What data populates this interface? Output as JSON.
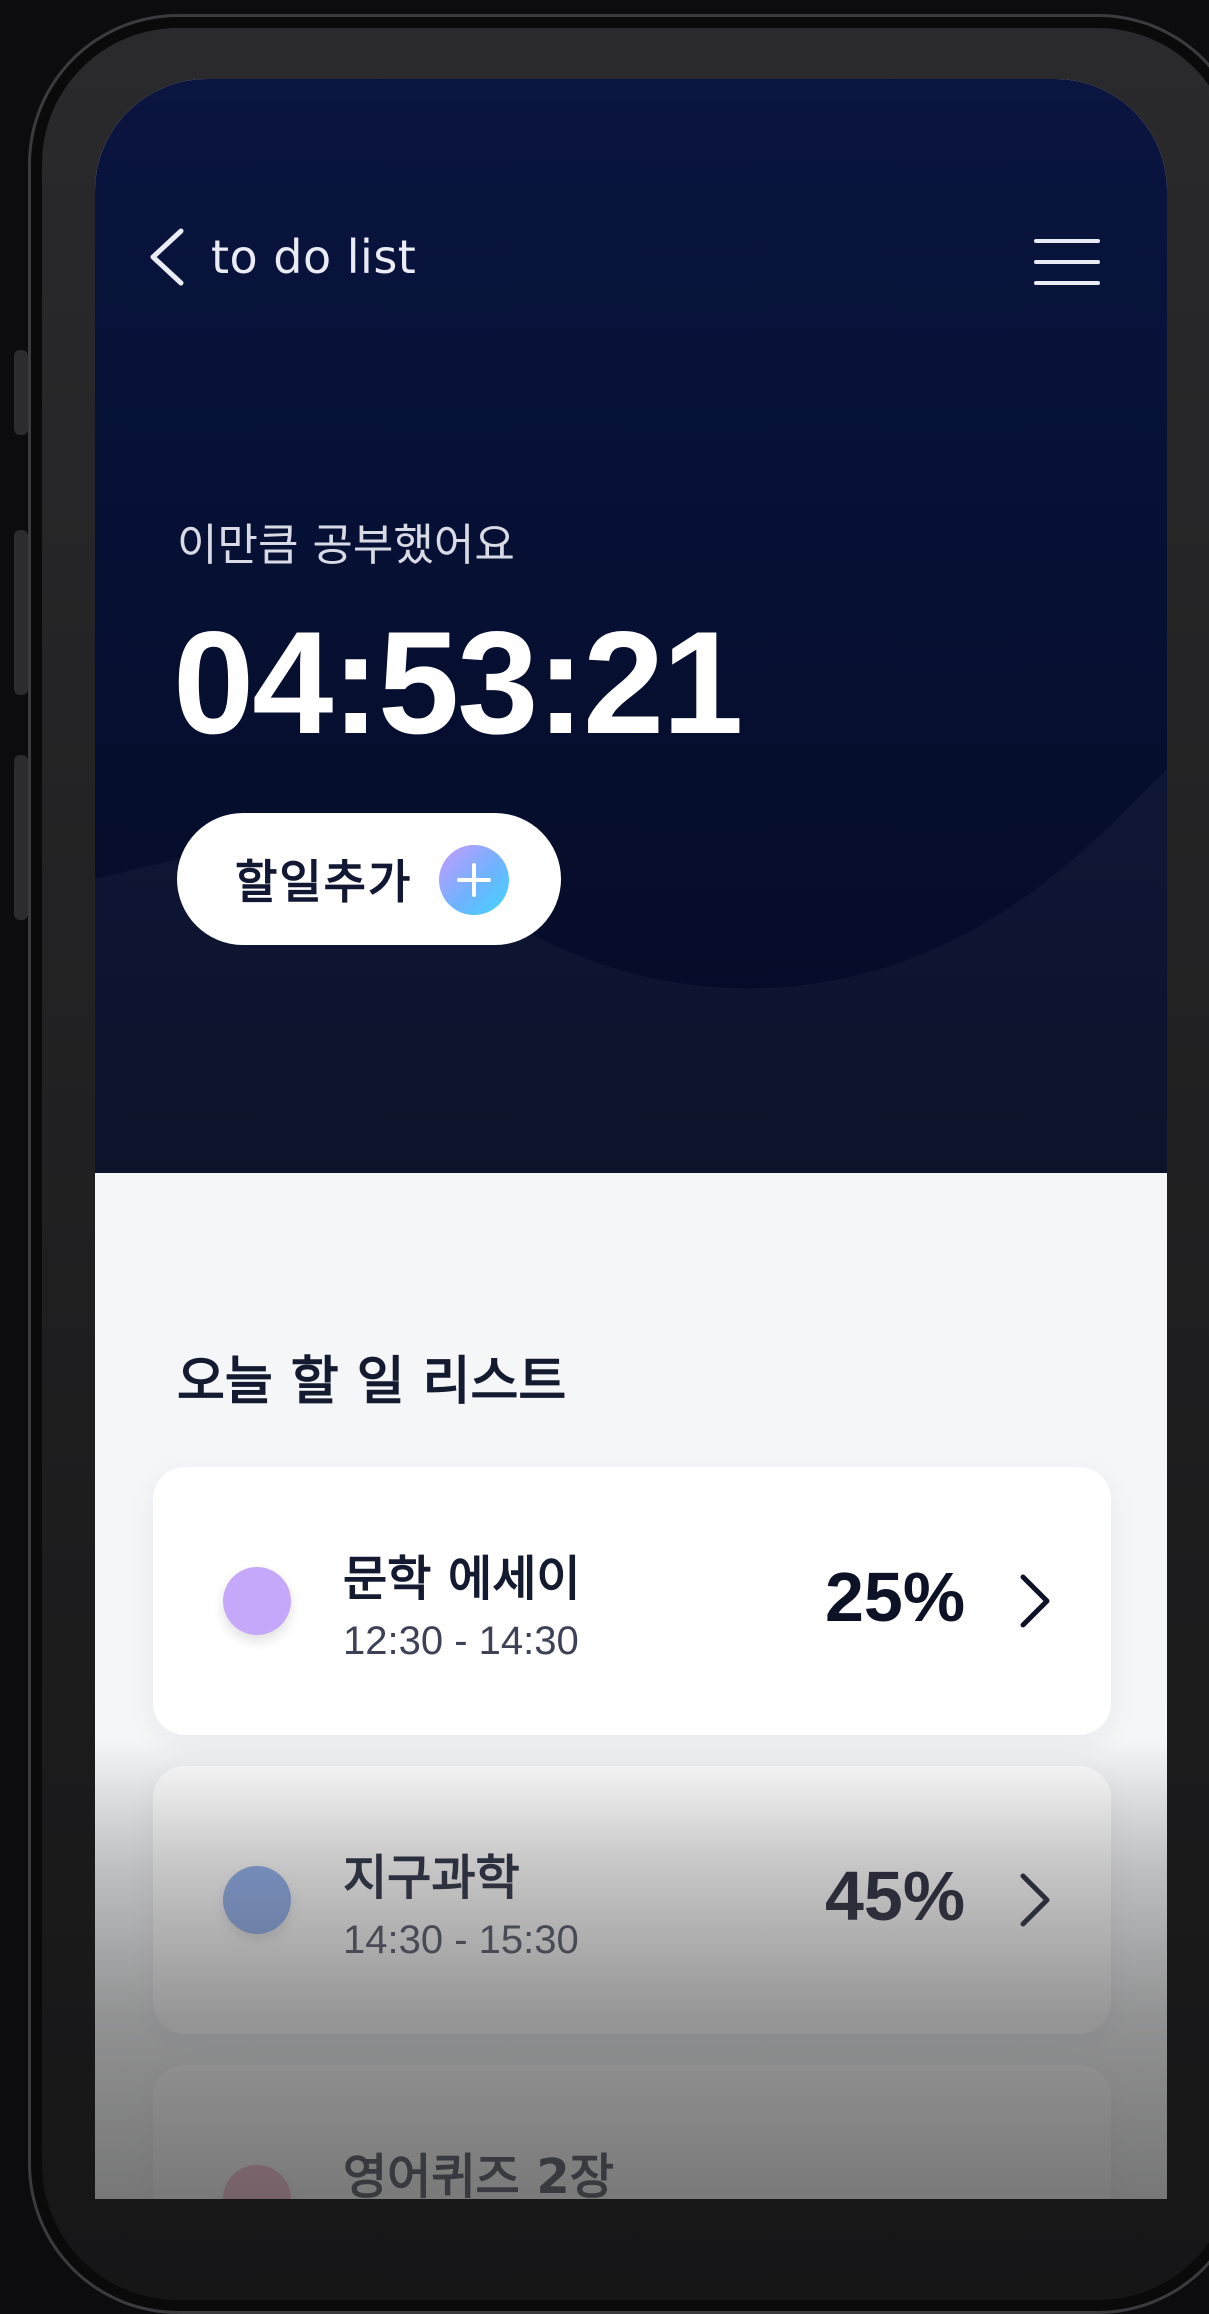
{
  "app": {
    "title": "to do list"
  },
  "hero": {
    "studied_label": "이만큼 공부했어요",
    "timer": "04:53:21",
    "add_button_label": "할일추가"
  },
  "today": {
    "section_title": "오늘 할 일 리스트",
    "tasks": [
      {
        "name": "문학 에세이",
        "time": "12:30 - 14:30",
        "percent": "25%",
        "color": "#c6a8fb"
      },
      {
        "name": "지구과학",
        "time": "14:30 - 15:30",
        "percent": "45%",
        "color": "#84a6ec"
      },
      {
        "name": "영어퀴즈 2장",
        "time": "",
        "percent": "",
        "color": "#f2a7c3"
      }
    ]
  },
  "colors": {
    "hero_bg": "#061033",
    "accent_gradient": [
      "#c79bff",
      "#3fd6ff"
    ],
    "text_dark": "#141a30"
  },
  "icons": {
    "back": "chevron-left-icon",
    "menu": "hamburger-menu-icon",
    "add": "plus-icon",
    "row": "chevron-right-icon"
  }
}
